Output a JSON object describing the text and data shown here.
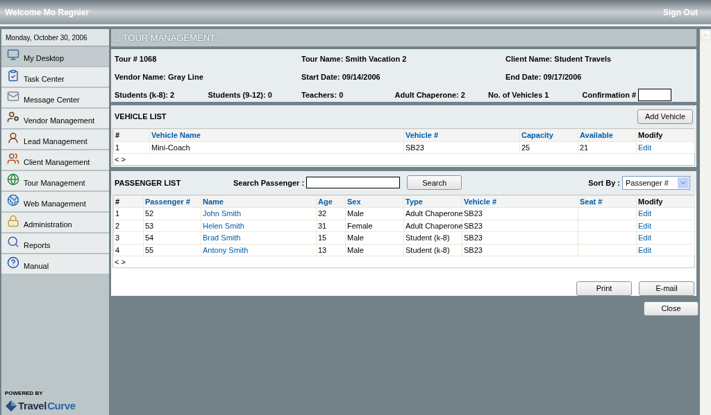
{
  "header": {
    "welcome": "Welcome Mo Regnier",
    "sign_out": "Sign Out"
  },
  "sidebar": {
    "date": "Monday, October 30, 2006",
    "items": [
      {
        "label": "My Desktop",
        "selected": true
      },
      {
        "label": "Task Center",
        "selected": false
      },
      {
        "label": "Message Center",
        "selected": false
      },
      {
        "label": "Vendor Management",
        "selected": false
      },
      {
        "label": "Lead Management",
        "selected": false
      },
      {
        "label": "Client Management",
        "selected": false
      },
      {
        "label": "Tour Management",
        "selected": false
      },
      {
        "label": "Web Management",
        "selected": false
      },
      {
        "label": "Administration",
        "selected": false
      },
      {
        "label": "Reports",
        "selected": false
      },
      {
        "label": "Manual",
        "selected": false
      }
    ],
    "powered_by": "POWERED BY",
    "logo": [
      "Travel",
      "Curve"
    ]
  },
  "page_title": ".: TOUR MANAGEMENT :.",
  "tour_details": {
    "top": [
      "Tour # 1068",
      "Tour Name: Smith Vacation 2",
      "Client Name: Student Travels",
      "Vendor Name: Gray Line",
      "Start Date: 09/14/2006",
      "End Date: 09/17/2006"
    ],
    "counts": [
      "Students (k-8): 2",
      "Students (9-12): 0",
      "Teachers: 0",
      "Adult Chaperone: 2",
      "No. of Vehicles 1"
    ],
    "confirmation_label": "Confirmation #"
  },
  "vehicle_list": {
    "title": "VEHICLE LIST",
    "add_button": "Add Vehicle",
    "columns": [
      {
        "label": "#",
        "sortable": false,
        "kind": "text"
      },
      {
        "label": "Vehicle Name",
        "sortable": true,
        "kind": "text"
      },
      {
        "label": "Vehicle #",
        "sortable": true,
        "kind": "text"
      },
      {
        "label": "Capacity",
        "sortable": true,
        "kind": "text"
      },
      {
        "label": "Available",
        "sortable": true,
        "kind": "text"
      },
      {
        "label": "Modify",
        "sortable": false,
        "kind": "link"
      }
    ],
    "rows": [
      [
        "1",
        "Mini-Coach",
        "SB23",
        "25",
        "21",
        "Edit"
      ]
    ],
    "pager": "< >"
  },
  "passenger_list": {
    "title": "PASSENGER LIST",
    "search_label": "Search Passenger :",
    "search_button": "Search",
    "sort_label": "Sort By :",
    "sort_value": "Passenger #",
    "columns": [
      {
        "label": "#",
        "sortable": false,
        "kind": "text"
      },
      {
        "label": "Passenger #",
        "sortable": true,
        "kind": "text"
      },
      {
        "label": "Name",
        "sortable": true,
        "kind": "link"
      },
      {
        "label": "Age",
        "sortable": true,
        "kind": "text"
      },
      {
        "label": "Sex",
        "sortable": true,
        "kind": "text"
      },
      {
        "label": "Type",
        "sortable": true,
        "kind": "text"
      },
      {
        "label": "Vehicle #",
        "sortable": true,
        "kind": "text"
      },
      {
        "label": "Seat #",
        "sortable": true,
        "kind": "text"
      },
      {
        "label": "Modify",
        "sortable": false,
        "kind": "link"
      }
    ],
    "rows": [
      [
        "1",
        "52",
        "John Smith",
        "32",
        "Male",
        "Adult Chaperone",
        "SB23",
        "",
        "Edit"
      ],
      [
        "2",
        "53",
        "Helen Smith",
        "31",
        "Female",
        "Adult Chaperone",
        "SB23",
        "",
        "Edit"
      ],
      [
        "3",
        "54",
        "Brad Smith",
        "15",
        "Male",
        "Student (k-8)",
        "SB23",
        "",
        "Edit"
      ],
      [
        "4",
        "55",
        "Antony Smith",
        "13",
        "Male",
        "Student (k-8)",
        "SB23",
        "",
        "Edit"
      ]
    ],
    "pager": "< >",
    "buttons": [
      "Print",
      "E-mail"
    ]
  },
  "close_button": "Close"
}
